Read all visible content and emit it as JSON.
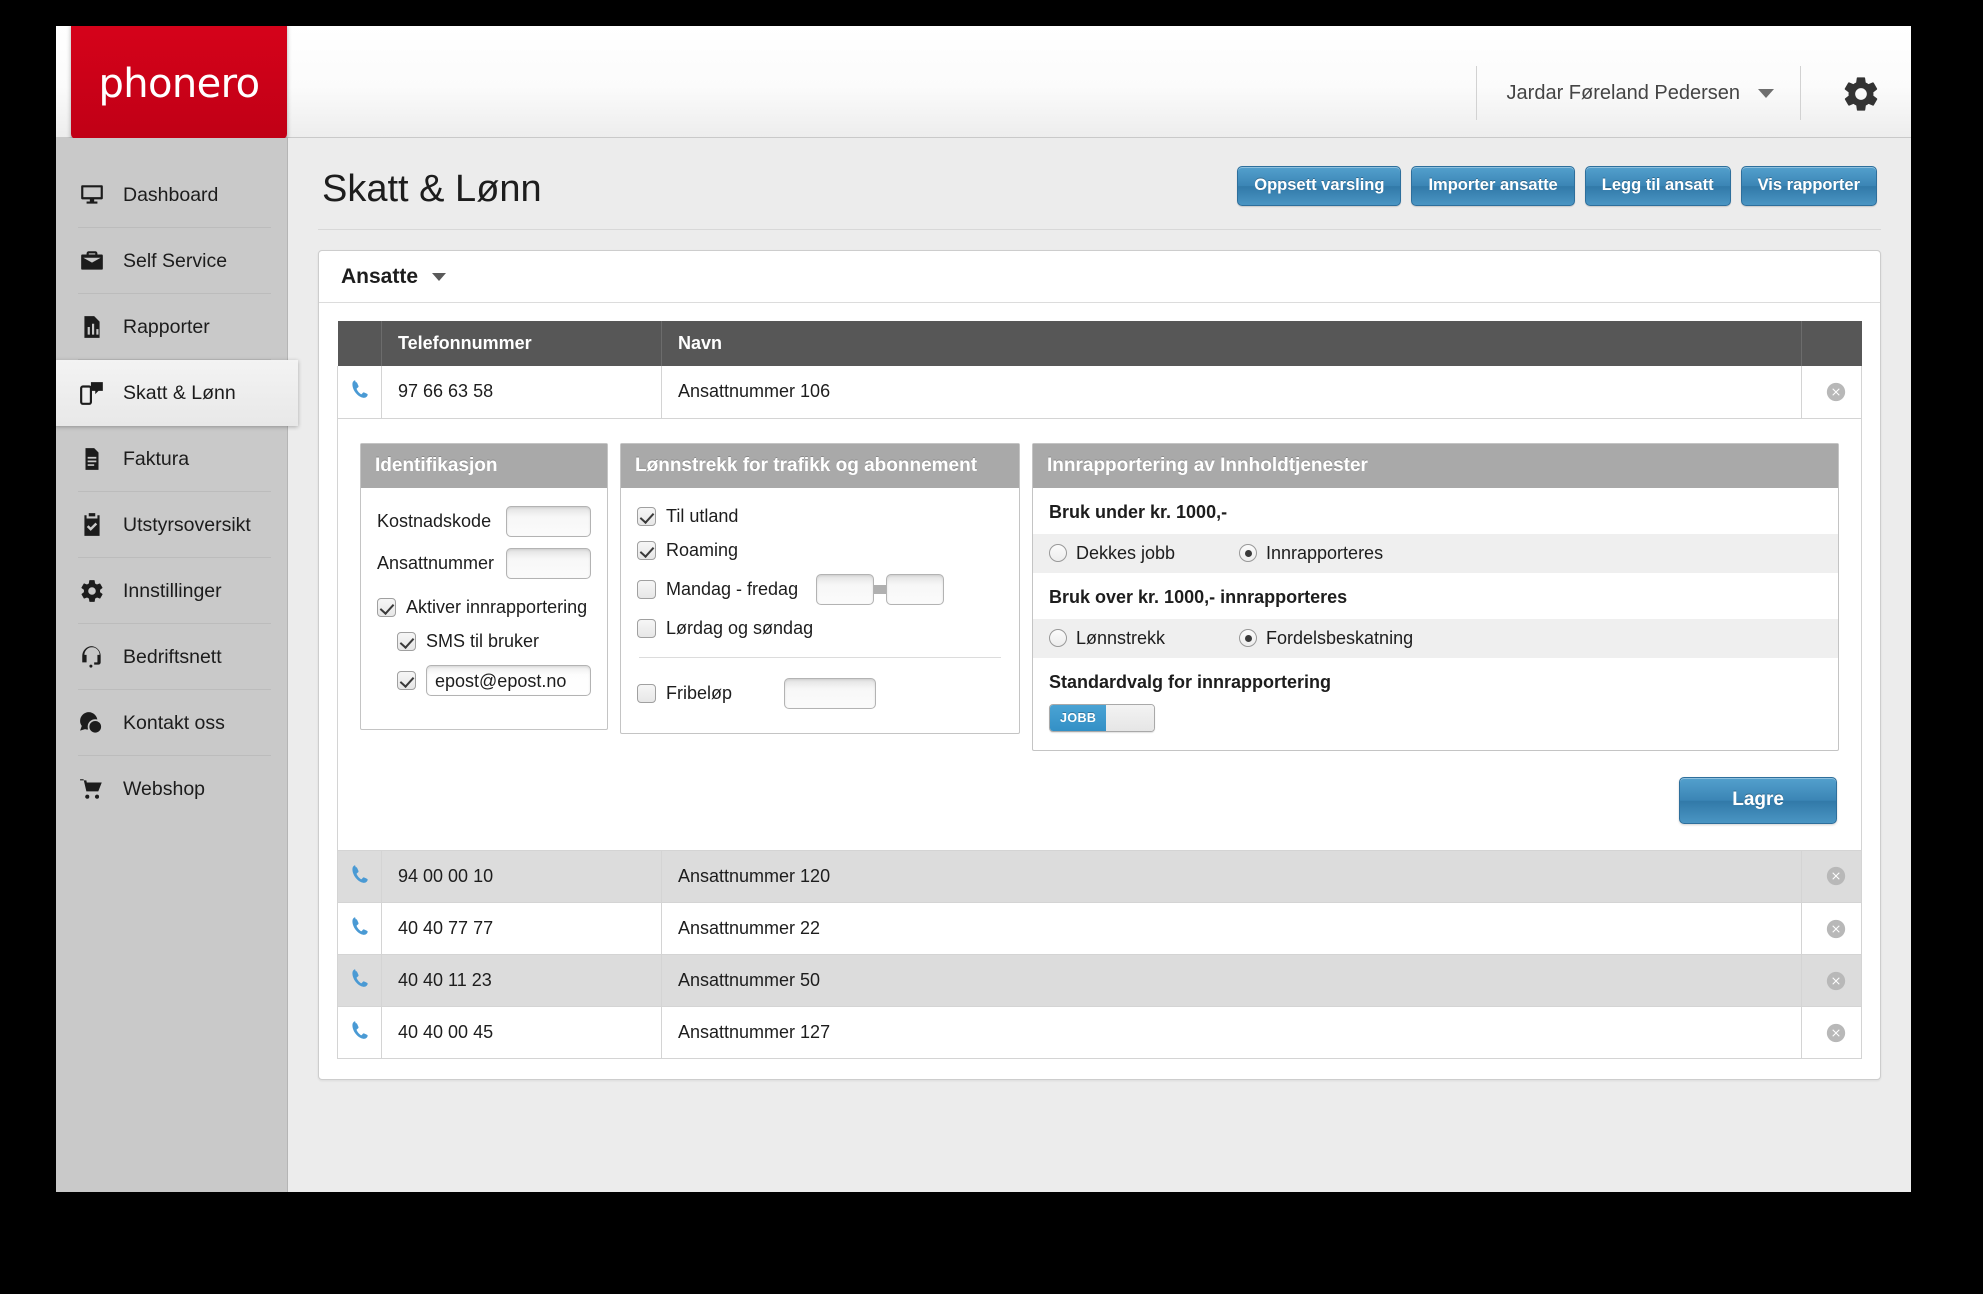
{
  "brand": {
    "logo_text": "phonero",
    "logo_color": "#cc0018",
    "accent_color": "#3b85b5"
  },
  "header": {
    "user_name": "Jardar Føreland Pedersen",
    "caret_icon": "chevron-down-icon",
    "settings_icon": "gear-icon"
  },
  "sidebar": {
    "items": [
      {
        "label": "Dashboard",
        "icon": "monitor-icon",
        "active": false
      },
      {
        "label": "Self Service",
        "icon": "briefcase-icon",
        "active": false
      },
      {
        "label": "Rapporter",
        "icon": "report-icon",
        "active": false
      },
      {
        "label": "Skatt & Lønn",
        "icon": "phone-chat-icon",
        "active": true
      },
      {
        "label": "Faktura",
        "icon": "document-icon",
        "active": false
      },
      {
        "label": "Utstyrsoversikt",
        "icon": "clipboard-icon",
        "active": false
      },
      {
        "label": "Innstillinger",
        "icon": "gear-icon",
        "active": false
      },
      {
        "label": "Bedriftsnett",
        "icon": "headset-icon",
        "active": false
      },
      {
        "label": "Kontakt oss",
        "icon": "chat-icon",
        "active": false
      },
      {
        "label": "Webshop",
        "icon": "cart-icon",
        "active": false
      }
    ]
  },
  "page": {
    "title": "Skatt & Lønn",
    "actions": [
      {
        "label": "Oppsett varsling"
      },
      {
        "label": "Importer ansatte"
      },
      {
        "label": "Legg til ansatt"
      },
      {
        "label": "Vis rapporter"
      }
    ]
  },
  "panel": {
    "bar_label": "Ansatte",
    "caret_icon": "chevron-down-icon"
  },
  "table": {
    "columns": [
      "",
      "Telefonnummer",
      "Navn",
      ""
    ],
    "rows": [
      {
        "phone": "97 66 63 58",
        "name": "Ansattnummer 106",
        "shade": "white",
        "expanded": true
      },
      {
        "phone": "94 00 00 10",
        "name": "Ansattnummer 120",
        "shade": "grey",
        "expanded": false
      },
      {
        "phone": "40 40 77 77",
        "name": "Ansattnummer 22",
        "shade": "white",
        "expanded": false
      },
      {
        "phone": "40 40 11 23",
        "name": "Ansattnummer 50",
        "shade": "grey",
        "expanded": false
      },
      {
        "phone": "40 40 00 45",
        "name": "Ansattnummer 127",
        "shade": "white",
        "expanded": false
      }
    ],
    "row_icon": "phone-icon",
    "remove_icon": "remove-circle-icon"
  },
  "detail": {
    "identifikasjon": {
      "title": "Identifikasjon",
      "kostnadskode_label": "Kostnadskode",
      "kostnadskode_value": "",
      "ansattnummer_label": "Ansattnummer",
      "ansattnummer_value": "",
      "aktiver_label": "Aktiver innrapportering",
      "aktiver_checked": true,
      "sms_label": "SMS til bruker",
      "sms_checked": true,
      "epost_checked": true,
      "epost_value": "epost@epost.no"
    },
    "lonnstrekk": {
      "title": "Lønnstrekk for trafikk og abonnement",
      "options": [
        {
          "label": "Til utland",
          "checked": true
        },
        {
          "label": "Roaming",
          "checked": true
        },
        {
          "label": "Mandag - fredag",
          "checked": false
        },
        {
          "label": "Lørdag og søndag",
          "checked": false
        }
      ],
      "time_from": "",
      "time_to": "",
      "fribelop_label": "Fribeløp",
      "fribelop_checked": false,
      "fribelop_value": ""
    },
    "innrapportering": {
      "title": "Innrapportering av Innholdtjenester",
      "section1_title": "Bruk under kr. 1000,-",
      "section1_options": [
        {
          "label": "Dekkes jobb",
          "selected": false
        },
        {
          "label": "Innrapporteres",
          "selected": true
        }
      ],
      "section2_title": "Bruk over kr. 1000,- innrapporteres",
      "section2_options": [
        {
          "label": "Lønnstrekk",
          "selected": false
        },
        {
          "label": "Fordelsbeskatning",
          "selected": true
        }
      ],
      "section3_title": "Standardvalg for innrapportering",
      "toggle_on_label": "JOBB",
      "toggle_state": "on"
    },
    "save_label": "Lagre"
  }
}
